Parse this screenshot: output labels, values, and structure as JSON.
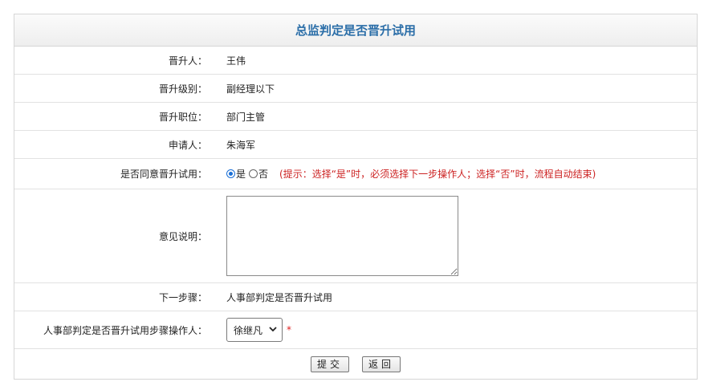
{
  "form": {
    "title": "总监判定是否晋升试用",
    "fields": {
      "promotee": {
        "label": "晋升人：",
        "value": "王伟"
      },
      "level": {
        "label": "晋升级别：",
        "value": "副经理以下"
      },
      "position": {
        "label": "晋升职位：",
        "value": "部门主管"
      },
      "applicant": {
        "label": "申请人：",
        "value": "朱海军"
      },
      "agree": {
        "label": "是否同意晋升试用：",
        "option_yes": "是",
        "option_no": "否",
        "selected": "是",
        "hint": "(提示：选择“是”时，必须选择下一步操作人；选择“否”时，流程自动结束)"
      },
      "opinion": {
        "label": "意见说明：",
        "value": ""
      },
      "next_step": {
        "label": "下一步骤：",
        "value": "人事部判定是否晋升试用"
      },
      "operator": {
        "label": "人事部判定是否晋升试用步骤操作人：",
        "selected": "徐继凡",
        "required_mark": "*"
      }
    },
    "buttons": {
      "submit": "提交",
      "back": "返回"
    }
  },
  "colors": {
    "title": "#2b6ea8",
    "hint": "#cc2222",
    "required": "#e02020",
    "radio_checked": "#1a6fd6"
  }
}
